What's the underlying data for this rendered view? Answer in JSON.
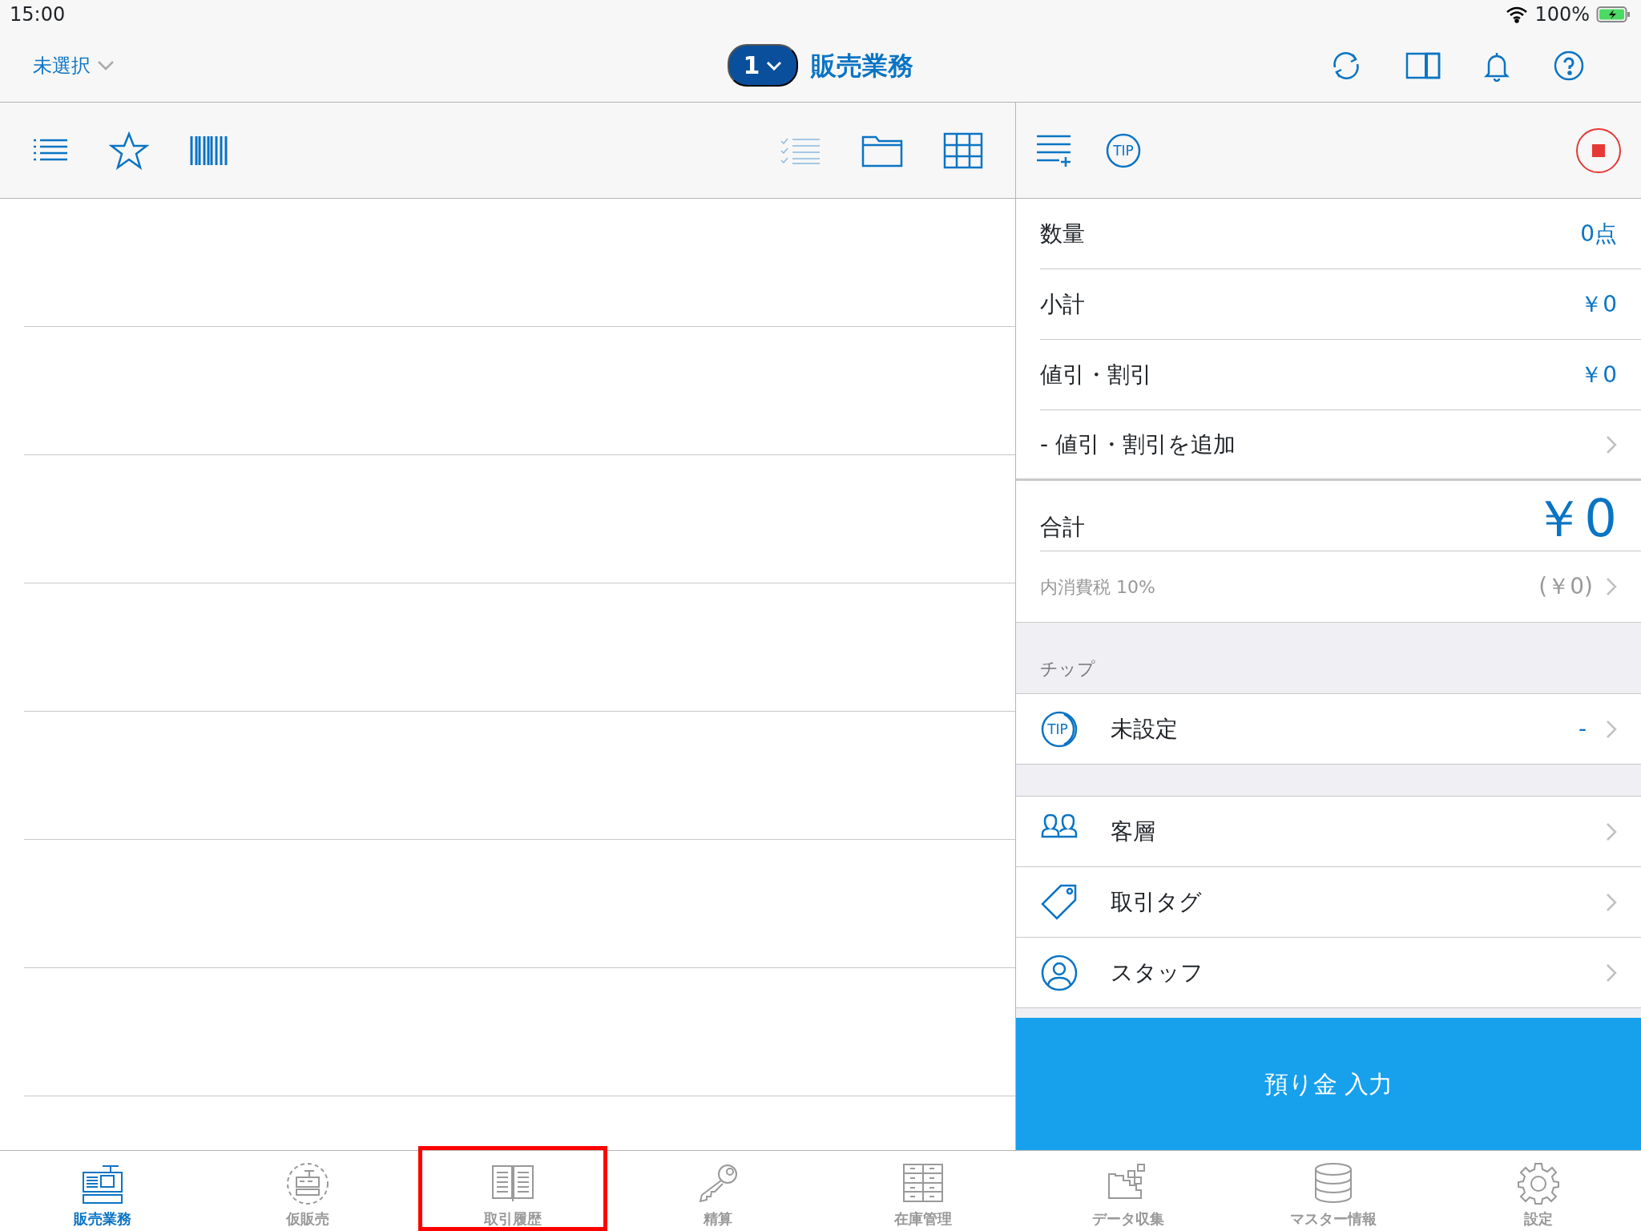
{
  "status_bar": {
    "time": "15:00",
    "battery": "100%"
  },
  "header": {
    "store_selector": "未選択",
    "register_number": "1",
    "title": "販売業務"
  },
  "summary": [
    {
      "kind": "value",
      "label": "数量",
      "value": "0点"
    },
    {
      "kind": "value",
      "label": "小計",
      "value": "￥0"
    },
    {
      "kind": "value",
      "label": "値引・割引",
      "value": "￥0"
    },
    {
      "kind": "link",
      "label": "- 値引・割引を追加"
    },
    {
      "kind": "total",
      "label": "合計",
      "value": "￥0"
    },
    {
      "kind": "tax",
      "label": "内消費税 10%",
      "value": "(￥0)"
    }
  ],
  "toolbar": {
    "tip_button": "TIP"
  },
  "tip_section": {
    "heading": "チップ",
    "icon_text": "TIP",
    "label": "未設定",
    "value": "-"
  },
  "options": [
    {
      "kind": "customers",
      "label": "客層"
    },
    {
      "kind": "tag",
      "label": "取引タグ"
    },
    {
      "kind": "staff",
      "label": "スタッフ"
    }
  ],
  "deposit_button": "預り金 入力",
  "tabs": [
    {
      "label": "販売業務",
      "selected": true,
      "highlighted": false
    },
    {
      "label": "仮販売",
      "selected": false,
      "highlighted": false
    },
    {
      "label": "取引履歴",
      "selected": false,
      "highlighted": true
    },
    {
      "label": "精算",
      "selected": false,
      "highlighted": false
    },
    {
      "label": "在庫管理",
      "selected": false,
      "highlighted": false
    },
    {
      "label": "データ収集",
      "selected": false,
      "highlighted": false
    },
    {
      "label": "マスター情報",
      "selected": false,
      "highlighted": false
    },
    {
      "label": "設定",
      "selected": false,
      "highlighted": false
    }
  ]
}
